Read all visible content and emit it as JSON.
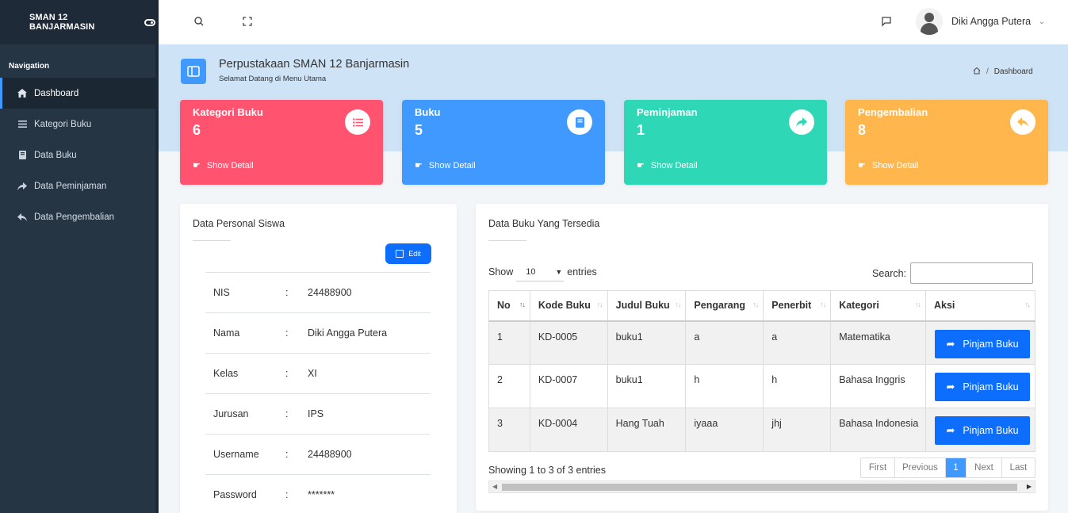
{
  "sidebar": {
    "brand": "SMAN 12 BANJARMASIN",
    "nav_heading": "Navigation",
    "items": [
      {
        "label": "Dashboard",
        "icon": "home-icon"
      },
      {
        "label": "Kategori Buku",
        "icon": "list-icon"
      },
      {
        "label": "Data Buku",
        "icon": "book-icon"
      },
      {
        "label": "Data Peminjaman",
        "icon": "share-arrow-icon"
      },
      {
        "label": "Data Pengembalian",
        "icon": "reply-arrow-icon"
      }
    ]
  },
  "topbar": {
    "user_name": "Diki Angga Putera"
  },
  "header": {
    "title": "Perpustakaan SMAN 12 Banjarmasin",
    "subtitle": "Selamat Datang di Menu Utama",
    "breadcrumb": "Dashboard"
  },
  "cards": [
    {
      "title": "Kategori Buku",
      "value": "6",
      "link": "Show Detail",
      "color": "#ff5370",
      "icon": "list-icon"
    },
    {
      "title": "Buku",
      "value": "5",
      "link": "Show Detail",
      "color": "#4099ff",
      "icon": "book-icon"
    },
    {
      "title": "Peminjaman",
      "value": "1",
      "link": "Show Detail",
      "color": "#2ed8b6",
      "icon": "share-arrow-icon"
    },
    {
      "title": "Pengembalian",
      "value": "8",
      "link": "Show Detail",
      "color": "#ffb64d",
      "icon": "reply-arrow-icon"
    }
  ],
  "personal": {
    "title": "Data Personal Siswa",
    "edit_label": "Edit",
    "rows": [
      {
        "label": "NIS",
        "sep": ":",
        "value": "24488900"
      },
      {
        "label": "Nama",
        "sep": ":",
        "value": "Diki Angga Putera"
      },
      {
        "label": "Kelas",
        "sep": ":",
        "value": "XI"
      },
      {
        "label": "Jurusan",
        "sep": ":",
        "value": "IPS"
      },
      {
        "label": "Username",
        "sep": ":",
        "value": "24488900"
      },
      {
        "label": "Password",
        "sep": ":",
        "value": "*******"
      }
    ]
  },
  "books": {
    "title": "Data Buku Yang Tersedia",
    "show_label": "Show",
    "entries_value": "10",
    "entries_label": "entries",
    "search_label": "Search:",
    "columns": [
      "No",
      "Kode Buku",
      "Judul Buku",
      "Pengarang",
      "Penerbit",
      "Kategori",
      "Aksi"
    ],
    "rows": [
      [
        "1",
        "KD-0005",
        "buku1",
        "a",
        "a",
        "Matematika"
      ],
      [
        "2",
        "KD-0007",
        "buku1",
        "h",
        "h",
        "Bahasa Inggris"
      ],
      [
        "3",
        "KD-0004",
        "Hang Tuah",
        "iyaaa",
        "jhj",
        "Bahasa Indonesia"
      ]
    ],
    "action_label": "Pinjam Buku",
    "info": "Showing 1 to 3 of 3 entries",
    "pager": {
      "first": "First",
      "previous": "Previous",
      "current": "1",
      "next": "Next",
      "last": "Last"
    }
  }
}
